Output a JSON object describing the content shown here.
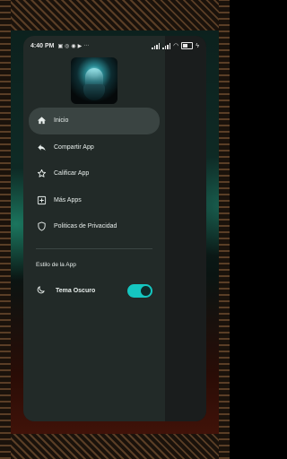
{
  "status_bar": {
    "time": "4:40 PM",
    "battery_level": 0.5
  },
  "drawer": {
    "menu": [
      {
        "label": "Inicio",
        "icon": "home-icon",
        "active": true
      },
      {
        "label": "Compartir App",
        "icon": "share-icon",
        "active": false
      },
      {
        "label": "Calificar App",
        "icon": "star-icon",
        "active": false
      },
      {
        "label": "Más Apps",
        "icon": "add-box-icon",
        "active": false
      },
      {
        "label": "Politicas de Privacidad",
        "icon": "shield-icon",
        "active": false
      }
    ],
    "section_title": "Estilo de la App",
    "theme": {
      "label": "Tema Oscuro",
      "enabled": true
    }
  },
  "colors": {
    "drawer_bg": "#222a28",
    "active_item_bg": "#3a4442",
    "switch_on": "#15c6c0"
  }
}
